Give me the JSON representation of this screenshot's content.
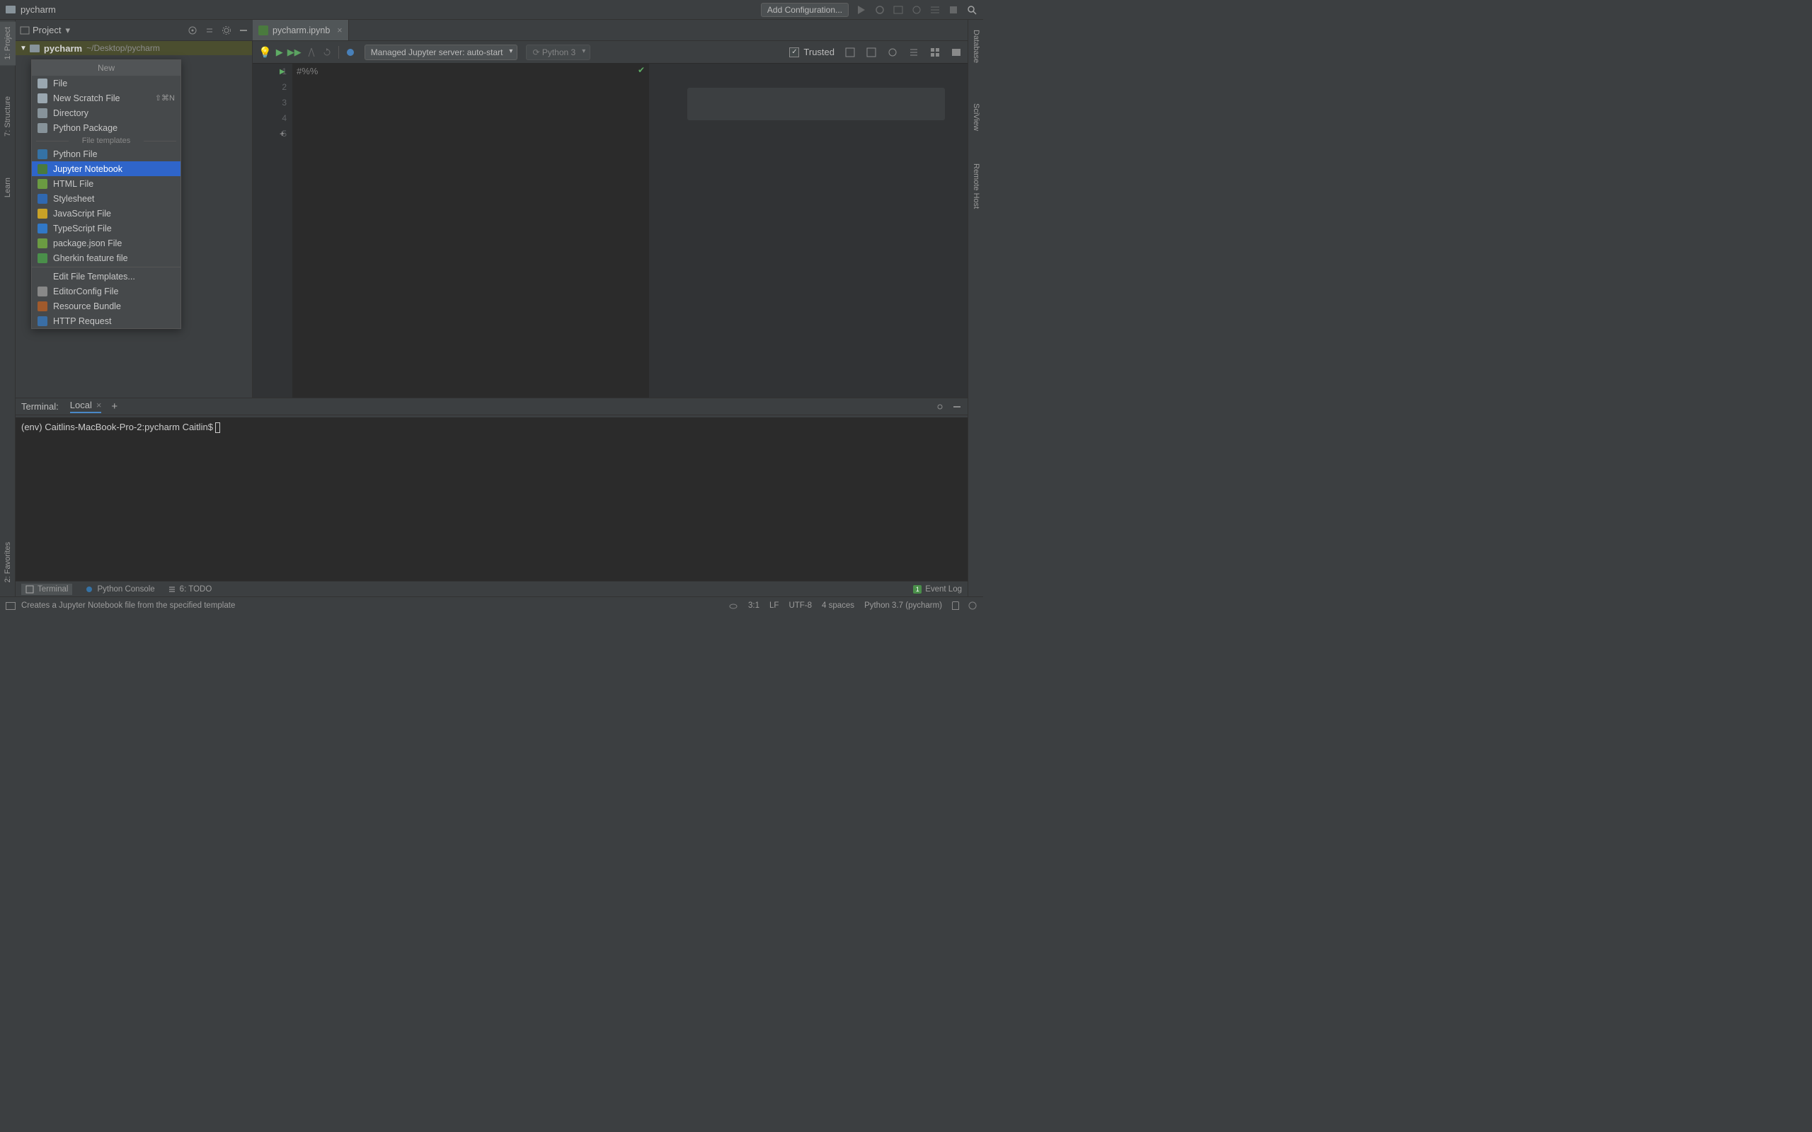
{
  "titlebar": {
    "project_name": "pycharm",
    "add_config": "Add Configuration..."
  },
  "left_rail": {
    "project": "1: Project",
    "structure": "7: Structure",
    "learn": "Learn",
    "favorites": "2: Favorites"
  },
  "right_rail": {
    "database": "Database",
    "sciview": "SciView",
    "remote": "Remote Host"
  },
  "proj_header": {
    "label": "Project"
  },
  "tree": {
    "root_name": "pycharm",
    "root_path": "~/Desktop/pycharm"
  },
  "context_menu": {
    "header": "New",
    "items_top": [
      {
        "label": "File",
        "color": "#9aa7b0"
      },
      {
        "label": "New Scratch File",
        "shortcut": "⇧⌘N",
        "color": "#9aa7b0"
      },
      {
        "label": "Directory",
        "color": "#87939a"
      },
      {
        "label": "Python Package",
        "color": "#87939a"
      }
    ],
    "sep_label": "File templates",
    "items_mid": [
      {
        "label": "Python File",
        "color": "#3572A5"
      },
      {
        "label": "Jupyter Notebook",
        "color": "#4a7a3e",
        "selected": true
      },
      {
        "label": "HTML File",
        "color": "#6b9b42"
      },
      {
        "label": "Stylesheet",
        "color": "#3068b0"
      },
      {
        "label": "JavaScript File",
        "color": "#c9a227"
      },
      {
        "label": "TypeScript File",
        "color": "#3178c6"
      },
      {
        "label": "package.json File",
        "color": "#6b9b42"
      },
      {
        "label": "Gherkin feature file",
        "color": "#4a8f4a"
      }
    ],
    "items_bot": [
      {
        "label": "Edit File Templates...",
        "color": ""
      },
      {
        "label": "EditorConfig File",
        "color": "#888"
      },
      {
        "label": "Resource Bundle",
        "color": "#a05a2c"
      },
      {
        "label": "HTTP Request",
        "color": "#3a6ea5"
      }
    ]
  },
  "editor_tab": {
    "name": "pycharm.ipynb"
  },
  "nb_toolbar": {
    "server_dd": "Managed Jupyter server: auto-start",
    "python_dd": "Python 3",
    "trusted": "Trusted"
  },
  "code": {
    "lines": [
      "1",
      "2",
      "3",
      "4",
      "5"
    ],
    "first_line_text": "#%%"
  },
  "terminal": {
    "header_label": "Terminal:",
    "tab_name": "Local",
    "prompt": "(env) Caitlins-MacBook-Pro-2:pycharm Caitlin$"
  },
  "bottom_tabs": {
    "terminal": "Terminal",
    "console": "Python Console",
    "todo": "6: TODO",
    "eventlog": "Event Log",
    "eventlog_badge": "1"
  },
  "status": {
    "hint": "Creates a Jupyter Notebook file from the specified template",
    "pos": "3:1",
    "eol": "LF",
    "enc": "UTF-8",
    "indent": "4 spaces",
    "interp": "Python 3.7 (pycharm)"
  }
}
